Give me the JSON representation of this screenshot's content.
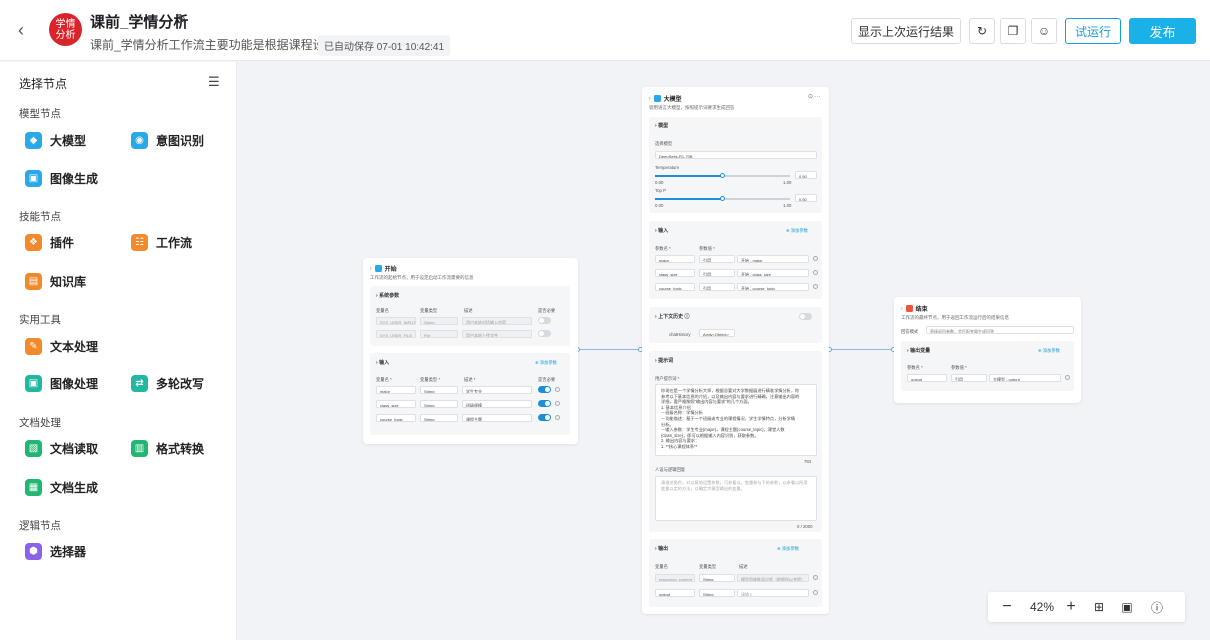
{
  "header": {
    "logo_text": "学情分析",
    "title": "课前_学情分析",
    "subtitle": "课前_学情分析工作流主要功能是根据课程设…",
    "autosave": "已自动保存 07-01 10:42:41",
    "show_last_result": "显示上次运行结果",
    "test_run": "试运行",
    "publish": "发布"
  },
  "sidebar": {
    "title": "选择节点",
    "groups": [
      {
        "name": "模型节点",
        "items": [
          "大模型",
          "意图识别",
          "图像生成"
        ]
      },
      {
        "name": "技能节点",
        "items": [
          "插件",
          "工作流",
          "知识库"
        ]
      },
      {
        "name": "实用工具",
        "items": [
          "文本处理",
          "图像处理",
          "多轮改写"
        ]
      },
      {
        "name": "文档处理",
        "items": [
          "文档读取",
          "格式转换",
          "文档生成"
        ]
      },
      {
        "name": "逻辑节点",
        "items": [
          "选择器"
        ]
      }
    ]
  },
  "start_node": {
    "title": "开始",
    "desc": "工作流的起始节点，用于设定启动工作流需要的信息",
    "sys_section": "系统参数",
    "headers": [
      "变量名",
      "变量类型",
      "描述",
      "是否必要"
    ],
    "sys_rows": [
      {
        "name": "SYS_USER_INPUT",
        "type": "String",
        "desc": "用户本轮对话输入内容"
      },
      {
        "name": "SYS_USER_FILE",
        "type": "File",
        "desc": "用户本轮上传文件"
      }
    ],
    "input_section": "输入",
    "add_param": "添加参数",
    "input_headers": [
      "变量名 *",
      "变量类型 *",
      "描述 *",
      "是否必要"
    ],
    "input_rows": [
      {
        "name": "major",
        "type": "String",
        "desc": "学生专业"
      },
      {
        "name": "class_size",
        "type": "String",
        "desc": "班级规模"
      },
      {
        "name": "course_topic",
        "type": "String",
        "desc": "课程主题"
      }
    ]
  },
  "llm_node": {
    "title": "大模型",
    "desc": "调用语言大模型，按照提示词要求生成回答",
    "model_section": "模型",
    "select_model_label": "选择模型",
    "model_value": "DeepSeek-R1-70B",
    "temperature_label": "Temperature",
    "temperature_value": "0.50",
    "temperature": 0.5,
    "top_p_label": "Top P",
    "top_p_value": "0.50",
    "top_p": 0.5,
    "range_min": "0.00",
    "range_max": "1.00",
    "input_section": "输入",
    "add_param": "添加参数",
    "param_headers": [
      "参数名 *",
      "参数值 *"
    ],
    "params": [
      {
        "name": "major",
        "kind": "引用",
        "value": "开始 - major"
      },
      {
        "name": "class_size",
        "kind": "引用",
        "value": "开始 - class_size"
      },
      {
        "name": "course_topic",
        "kind": "引用",
        "value": "开始 - course_topic"
      }
    ],
    "context_section": "上下文历史",
    "chat_history": "chatHistory",
    "chat_type": "Array<Object>",
    "prompt_section": "提示词",
    "user_prompt_label": "用户提示词 *",
    "prompt_lines": [
      "你现在是一个学情分析大师，根据总要对大学数据展进行精准学情分析，你",
      "参考以下基本信息的介绍，以及输出内容与要求进行精确，注意输出内容的",
      "详细，要严格按照“输出内容与要求”的几个方面。",
      "1. 基本信息介绍",
      "  －班级名称：学情分析",
      "  －功能描述：基于一个班级或专业的课程情况，学生学情特点，分析学情",
      "分析。",
      "  －输入参数：学生专业{major}，课程主题{course_topic}，课堂人数",
      "{class_size}，即可以根据输入内容识别，获取参数。",
      "2. 输出内容与要求：",
      "  1. **核心课程体系**"
    ],
    "prompt_count": "784",
    "reasoning_label": "人设与逻辑回复",
    "reasoning_placeholder": "请描述角色，对以意地设置参数，可参看以，变量参与下的参数，以参看以所用变量以定的方法，以确定大模型输出的变量。",
    "reasoning_count": "0 / 2000",
    "output_section": "输出",
    "output_headers": [
      "变量名",
      "变量类型",
      "描述"
    ],
    "outputs": [
      {
        "name": "reasoning_content",
        "type": "String",
        "desc": "模型思维推导过程（根据所以并提）"
      },
      {
        "name": "output",
        "type": "String",
        "desc": "请输入"
      }
    ]
  },
  "end_node": {
    "title": "结束",
    "desc": "工作流的最终节点，用于返回工作流运行后的结果信息",
    "mode_label": "回答模式",
    "mode_value": "直接返回参数，会匹配变量生成回答",
    "output_section": "输出变量",
    "add_param": "添加参数",
    "headers": [
      "参数名 *",
      "参数值 *"
    ],
    "rows": [
      {
        "name": "output",
        "kind": "引用",
        "value": "大模型 - output"
      }
    ]
  },
  "zoom": {
    "level": "42%"
  }
}
